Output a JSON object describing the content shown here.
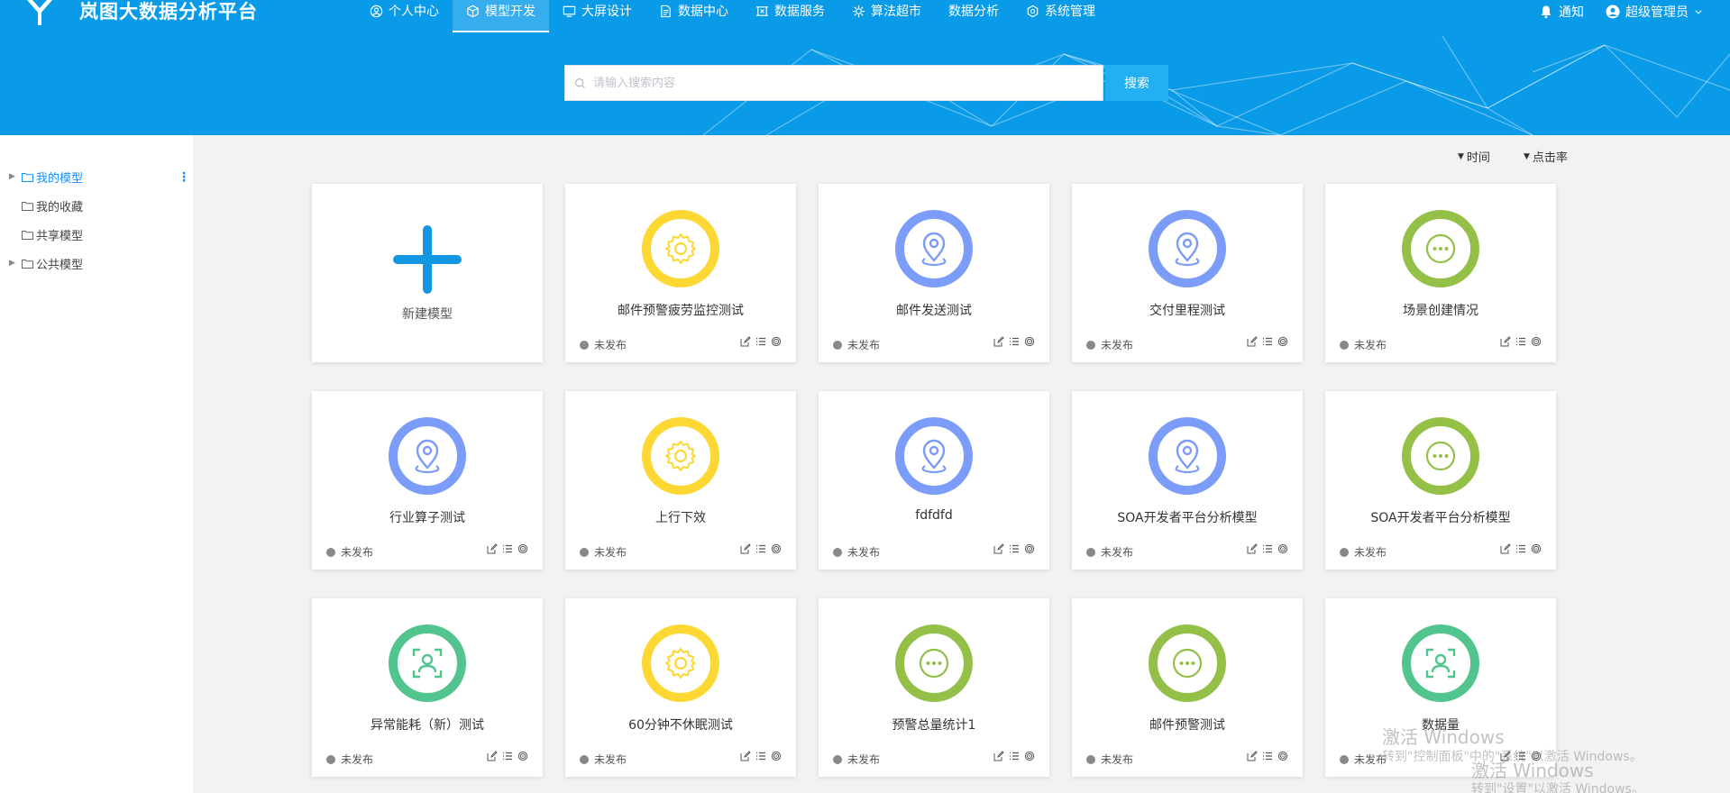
{
  "app": {
    "title": "岚图大数据分析平台"
  },
  "nav": [
    {
      "label": "个人中心",
      "icon": "user-circle-icon",
      "active": false
    },
    {
      "label": "模型开发",
      "icon": "cube-icon",
      "active": true
    },
    {
      "label": "大屏设计",
      "icon": "monitor-icon",
      "active": false
    },
    {
      "label": "数据中心",
      "icon": "document-icon",
      "active": false
    },
    {
      "label": "数据服务",
      "icon": "service-icon",
      "active": false
    },
    {
      "label": "算法超市",
      "icon": "gear-network-icon",
      "active": false
    },
    {
      "label": "数据分析",
      "icon": "",
      "active": false
    },
    {
      "label": "系统管理",
      "icon": "settings-icon",
      "active": false
    }
  ],
  "header_right": {
    "notify": "通知",
    "user": "超级管理员"
  },
  "search": {
    "placeholder": "请输入搜索内容",
    "button": "搜索"
  },
  "sidebar": {
    "items": [
      {
        "label": "我的模型",
        "active": true,
        "expandable": true
      },
      {
        "label": "我的收藏",
        "active": false,
        "expandable": false
      },
      {
        "label": "共享模型",
        "active": false,
        "expandable": false
      },
      {
        "label": "公共模型",
        "active": false,
        "expandable": true
      }
    ]
  },
  "sort": {
    "time": "时间",
    "clicks": "点击率"
  },
  "new_card": {
    "label": "新建模型"
  },
  "cards": [
    {
      "name": "邮件预警疲劳监控测试",
      "status": "未发布",
      "icon": "gear-icon",
      "color": "#fdd835"
    },
    {
      "name": "邮件发送测试",
      "status": "未发布",
      "icon": "location-pin-icon",
      "color": "#7b9cf8"
    },
    {
      "name": "交付里程测试",
      "status": "未发布",
      "icon": "location-pin-icon",
      "color": "#7b9cf8"
    },
    {
      "name": "场景创建情况",
      "status": "未发布",
      "icon": "more-dots-icon",
      "color": "#95c047"
    },
    {
      "name": "行业算子测试",
      "status": "未发布",
      "icon": "location-pin-icon",
      "color": "#7b9cf8"
    },
    {
      "name": "上行下效",
      "status": "未发布",
      "icon": "gear-icon",
      "color": "#fdd835"
    },
    {
      "name": "fdfdfd",
      "status": "未发布",
      "icon": "location-pin-icon",
      "color": "#7b9cf8"
    },
    {
      "name": "SOA开发者平台分析模型",
      "status": "未发布",
      "icon": "location-pin-icon",
      "color": "#7b9cf8"
    },
    {
      "name": "SOA开发者平台分析模型",
      "status": "未发布",
      "icon": "more-dots-icon",
      "color": "#95c047"
    },
    {
      "name": "异常能耗（新）测试",
      "status": "未发布",
      "icon": "face-scan-icon",
      "color": "#52c58e"
    },
    {
      "name": "60分钟不休眠测试",
      "status": "未发布",
      "icon": "gear-icon",
      "color": "#fdd835"
    },
    {
      "name": "预警总量统计1",
      "status": "未发布",
      "icon": "more-dots-icon",
      "color": "#95c047"
    },
    {
      "name": "邮件预警测试",
      "status": "未发布",
      "icon": "more-dots-icon",
      "color": "#95c047"
    },
    {
      "name": "数据量",
      "status": "未发布",
      "icon": "face-scan-icon",
      "color": "#52c58e"
    }
  ],
  "watermark": {
    "line1": "激活 Windows",
    "line2": "转到\"控制面板\"中的\"系统\"以激活 Windows。",
    "line3": "激活 Windows",
    "line4": "转到\"设置\"以激活 Windows。"
  }
}
